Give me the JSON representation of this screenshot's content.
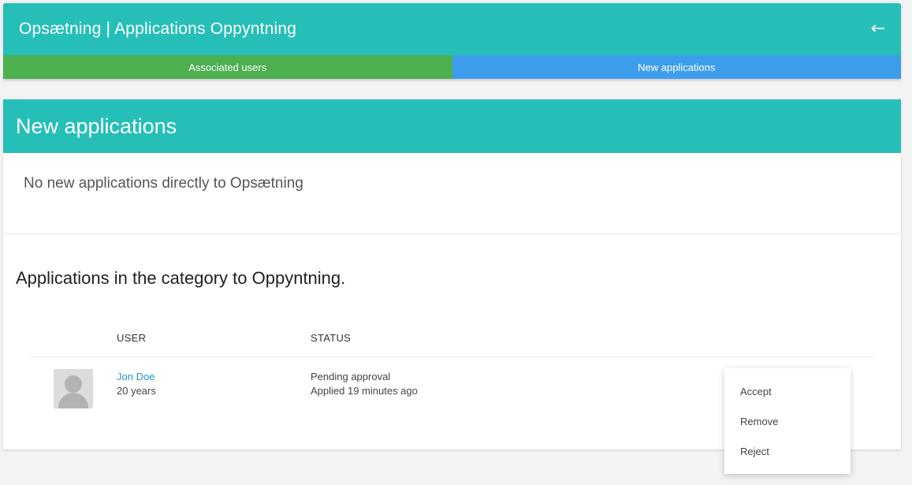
{
  "header": {
    "title": "Opsætning | Applications Oppyntning",
    "back_icon": "arrow-left-icon",
    "color": "#26bfb8"
  },
  "tabs": [
    {
      "label": "Associated users",
      "color": "#4caf50"
    },
    {
      "label": "New applications",
      "color": "#3d9ded"
    }
  ],
  "card": {
    "header_title": "New applications",
    "empty_message": "No new applications directly to Opsætning",
    "category_title": "Applications in the category to Oppyntning.",
    "columns": [
      "USER",
      "STATUS"
    ],
    "rows": [
      {
        "avatar_icon": "default-avatar-icon",
        "name": "Jon Doe",
        "age": "20 years",
        "status": "Pending approval",
        "applied": "Applied 19 minutes ago"
      }
    ]
  },
  "action_menu": {
    "items": [
      "Accept",
      "Remove",
      "Reject"
    ]
  }
}
